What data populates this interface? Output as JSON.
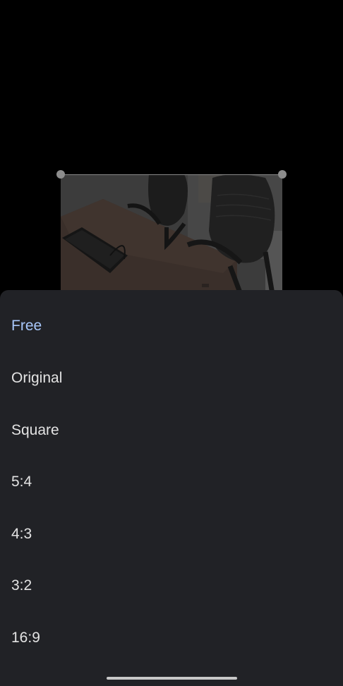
{
  "crop_options": [
    {
      "label": "Free",
      "selected": true
    },
    {
      "label": "Original",
      "selected": false
    },
    {
      "label": "Square",
      "selected": false
    },
    {
      "label": "5:4",
      "selected": false
    },
    {
      "label": "4:3",
      "selected": false
    },
    {
      "label": "3:2",
      "selected": false
    },
    {
      "label": "16:9",
      "selected": false
    }
  ],
  "colors": {
    "sheet_background": "#212226",
    "selected_text": "#a8c7fa",
    "option_text": "#e3e3e3"
  }
}
